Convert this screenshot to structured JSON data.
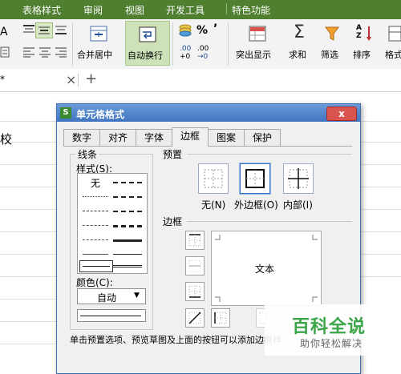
{
  "menu": {
    "items": [
      "表格样式",
      "审阅",
      "视图",
      "开发工具",
      "特色功能"
    ]
  },
  "ribbon": {
    "merge_label": "合并居中",
    "wrap_label": "自动换行",
    "percent_glyph": "%",
    "comma_glyph": "’",
    "decimal_inc": ".00",
    "decimal_dec": ".00",
    "highlight_label": "突出显示",
    "sum_label": "求和",
    "filter_label": "筛选",
    "sort_label": "排序",
    "format_label": "格式"
  },
  "tabbar": {
    "tab_asterisk": "*",
    "close_glyph": "×",
    "add_glyph": "+"
  },
  "sheet": {
    "cell_text": "校"
  },
  "dialog": {
    "title": "单元格格式",
    "logo": "S",
    "close_glyph": "x",
    "tabs": [
      "数字",
      "对齐",
      "字体",
      "边框",
      "图案",
      "保护"
    ],
    "selected_tab": "边框",
    "line_group": "线条",
    "style_label": "样式(S):",
    "style_none": "无",
    "color_label": "颜色(C):",
    "color_value": "自动",
    "preset_group": "预置",
    "preset_labels": [
      "无(N)",
      "外边框(O)",
      "内部(I)"
    ],
    "border_group": "边框",
    "preview_text": "文本",
    "hint": "单击预置选项、预览草图及上面的按钮可以添加边框样"
  },
  "watermark": {
    "brand": "百科全说",
    "slogan": "助你轻松解决"
  },
  "colors": {
    "menu_bg": "#4f7f2f",
    "accent_blue": "#3a73c0",
    "wrap_highlight": "#cde2b8"
  }
}
